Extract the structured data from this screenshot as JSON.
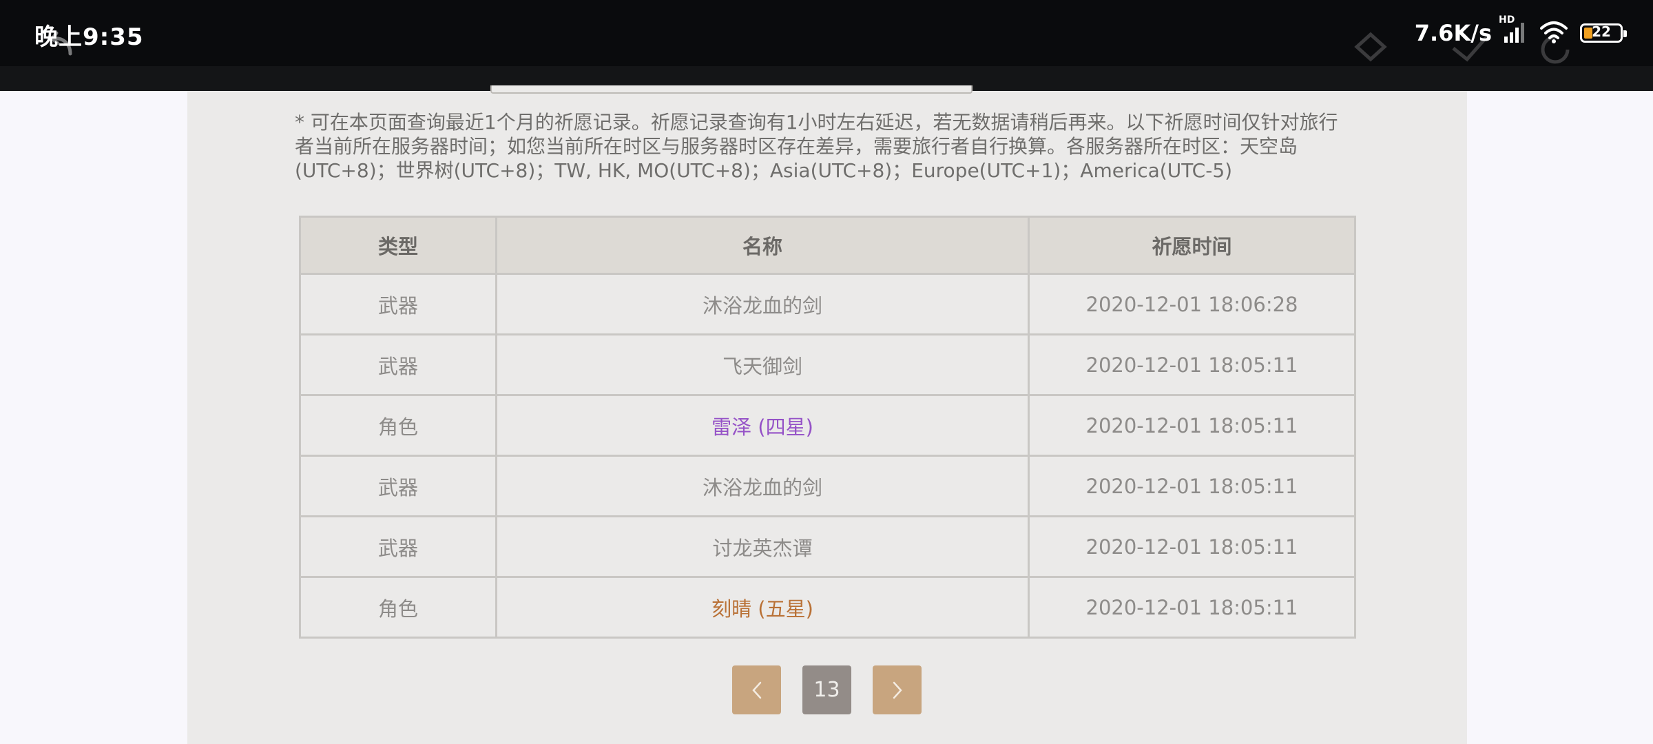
{
  "status_bar": {
    "time": "晚上9:35",
    "net_speed": "7.6K/s",
    "network_badge": "HD",
    "battery_level": "22",
    "icons": [
      "back-ghost-icon",
      "signal-icon",
      "wifi-icon",
      "battery-icon"
    ]
  },
  "notice": "* 可在本页面查询最近1个月的祈愿记录。祈愿记录查询有1小时左右延迟，若无数据请稍后再来。以下祈愿时间仅针对旅行者当前所在服务器时间；如您当前所在时区与服务器时区存在差异，需要旅行者自行换算。各服务器所在时区：天空岛(UTC+8)；世界树(UTC+8)；TW, HK, MO(UTC+8)；Asia(UTC+8)；Europe(UTC+1)；America(UTC-5)",
  "table": {
    "headers": [
      "类型",
      "名称",
      "祈愿时间"
    ],
    "rows": [
      {
        "type": "武器",
        "name": "沐浴龙血的剑",
        "time": "2020-12-01 18:06:28",
        "rarity_color": "#8d8b89"
      },
      {
        "type": "武器",
        "name": "飞天御剑",
        "time": "2020-12-01 18:05:11",
        "rarity_color": "#8d8b89"
      },
      {
        "type": "角色",
        "name": "雷泽 (四星)",
        "time": "2020-12-01 18:05:11",
        "rarity_color": "#9552c7"
      },
      {
        "type": "武器",
        "name": "沐浴龙血的剑",
        "time": "2020-12-01 18:05:11",
        "rarity_color": "#8d8b89"
      },
      {
        "type": "武器",
        "name": "讨龙英杰谭",
        "time": "2020-12-01 18:05:11",
        "rarity_color": "#8d8b89"
      },
      {
        "type": "角色",
        "name": "刻晴 (五星)",
        "time": "2020-12-01 18:05:11",
        "rarity_color": "#b97136"
      }
    ]
  },
  "pagination": {
    "current_page": "13",
    "prev_icon": "chevron-left-icon",
    "next_icon": "chevron-right-icon"
  },
  "colors": {
    "four_star": "#9552c7",
    "five_star": "#b97136",
    "pager_button": "#c8a57f",
    "pager_current": "#938c88"
  }
}
